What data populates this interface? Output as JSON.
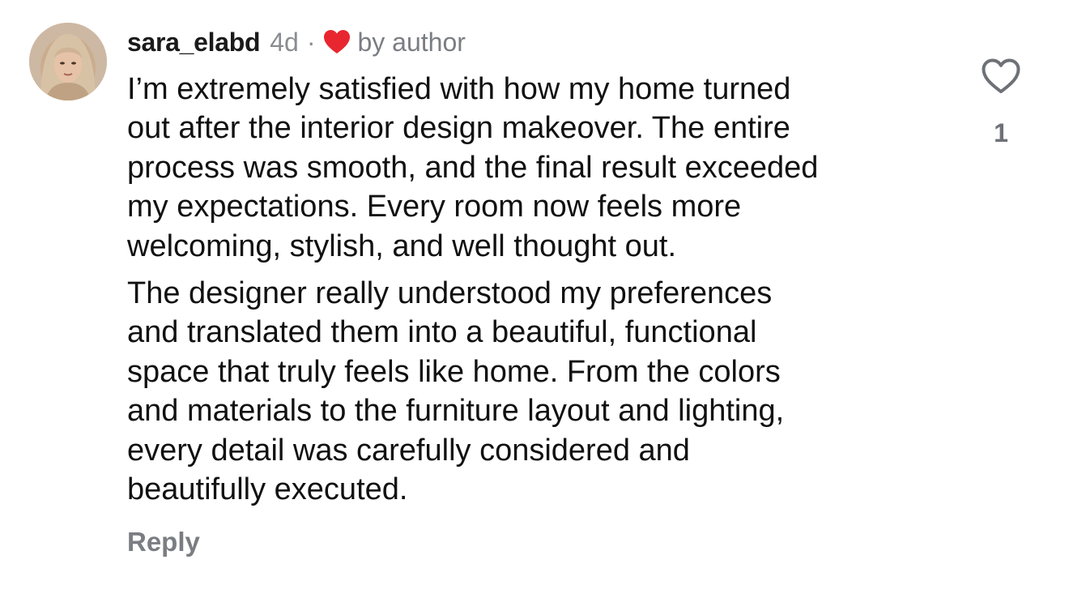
{
  "comment": {
    "username": "sara_elabd",
    "time": "4d",
    "separator": "·",
    "author_badge_icon": "red-heart-icon",
    "author_badge_color": "#e8262f",
    "author_badge_text": "by author",
    "paragraphs": [
      "I’m extremely satisfied with how my home turned\nout after the interior design makeover. The entire\nprocess was smooth, and the final result exceeded\nmy expectations. Every room now feels more\nwelcoming, stylish, and well thought out.",
      "The designer really understood my preferences\nand translated them into a beautiful, functional\nspace that truly feels like home. From the colors\nand materials to the furniture layout and lighting,\nevery detail was carefully considered and\nbeautifully executed."
    ],
    "reply_label": "Reply",
    "like_icon": "heart-outline-icon",
    "like_count": "1"
  }
}
